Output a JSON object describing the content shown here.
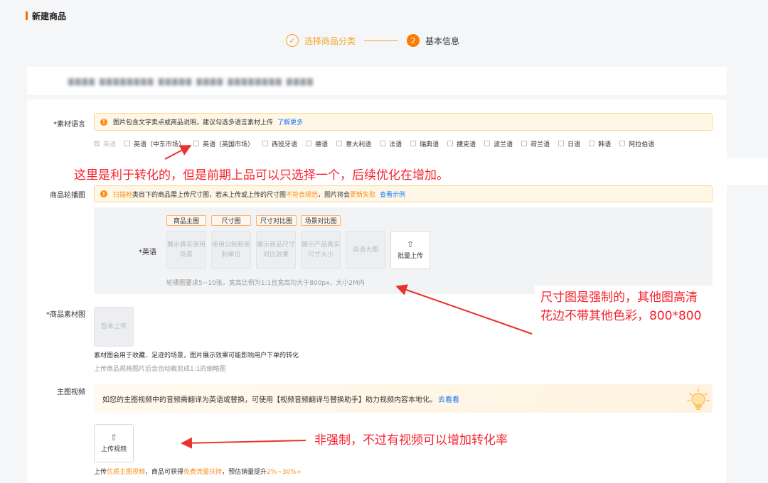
{
  "page": {
    "title": "新建商品"
  },
  "steps": [
    {
      "label": "选择商品分类",
      "status": "done",
      "icon": "check-icon"
    },
    {
      "number": "2",
      "label": "基本信息",
      "status": "active"
    }
  ],
  "material_language": {
    "label": "*素材语言",
    "notice": {
      "text": "图片包含文字卖点或商品说明，建议勾选多语言素材上传",
      "link": "了解更多"
    },
    "languages": [
      {
        "label": "英语",
        "checked": true,
        "disabled": true
      },
      {
        "label": "英语（中东市场）",
        "checked": false
      },
      {
        "label": "英语（英国市场）",
        "checked": false
      },
      {
        "label": "西班牙语",
        "checked": false
      },
      {
        "label": "德语",
        "checked": false
      },
      {
        "label": "意大利语",
        "checked": false
      },
      {
        "label": "法语",
        "checked": false
      },
      {
        "label": "瑞典语",
        "checked": false
      },
      {
        "label": "捷克语",
        "checked": false
      },
      {
        "label": "波兰语",
        "checked": false
      },
      {
        "label": "荷兰语",
        "checked": false
      },
      {
        "label": "日语",
        "checked": false
      },
      {
        "label": "韩语",
        "checked": false
      },
      {
        "label": "阿拉伯语",
        "checked": false
      }
    ]
  },
  "carousel": {
    "label": "商品轮播图",
    "notice": {
      "prefix": "扫描枪",
      "middle1": "类目下的商品需上传尺寸图，若未上传或上传的尺寸图",
      "highlight1": "不符合规范",
      "middle2": "，图片将会",
      "highlight2": "更新失败",
      "link": "查看示例"
    },
    "row_label": "*英语",
    "slot_tags": [
      "商品主图",
      "尺寸图",
      "尺寸对比图",
      "场景对比图"
    ],
    "slots": [
      "展示真实使用场景",
      "使用公制和英制单位",
      "展示商品尺寸对比效果",
      "展示产品真实尺寸大小",
      "高清大图"
    ],
    "bulk_upload": "批量上传",
    "hint": "轮播图要求5~10张，宽高比例为1:1且宽高均大于800px，大小2M内"
  },
  "material_image": {
    "label": "*商品素材图",
    "placeholder": "暂未上传",
    "desc": "素材图会用于收藏、足迹的场景，图片展示效果可能影响用户下单的转化",
    "hint": "上传商品规格图片后会自动裁剪成1:1的缩略图"
  },
  "main_video": {
    "label": "主图视频",
    "banner": {
      "text": "如您的主图视频中的音频需翻译为英语或替换，可使用【视频音频翻译与替换助手】助力视频内容本地化。",
      "link": "去看看",
      "icon": "lightbulb-icon"
    },
    "upload": "上传视频",
    "footer": {
      "p1": "上传",
      "h1": "优质主图视频",
      "p2": "，商品可获得",
      "h2": "免费流量扶持",
      "p3": "，预估销量提升",
      "h3": "2%~30%+"
    }
  },
  "annotations": {
    "language": "这里是利于转化的，但是前期上品可以只选择一个，后续优化在增加。",
    "size_line1": "尺寸图是强制的，其他图高清",
    "size_line2": "花边不带其他色彩，800*800",
    "video": "非强制，不过有视频可以增加转化率"
  },
  "colors": {
    "accent": "#ff7a00",
    "annotation": "#f5222d",
    "link": "#1677ff"
  }
}
